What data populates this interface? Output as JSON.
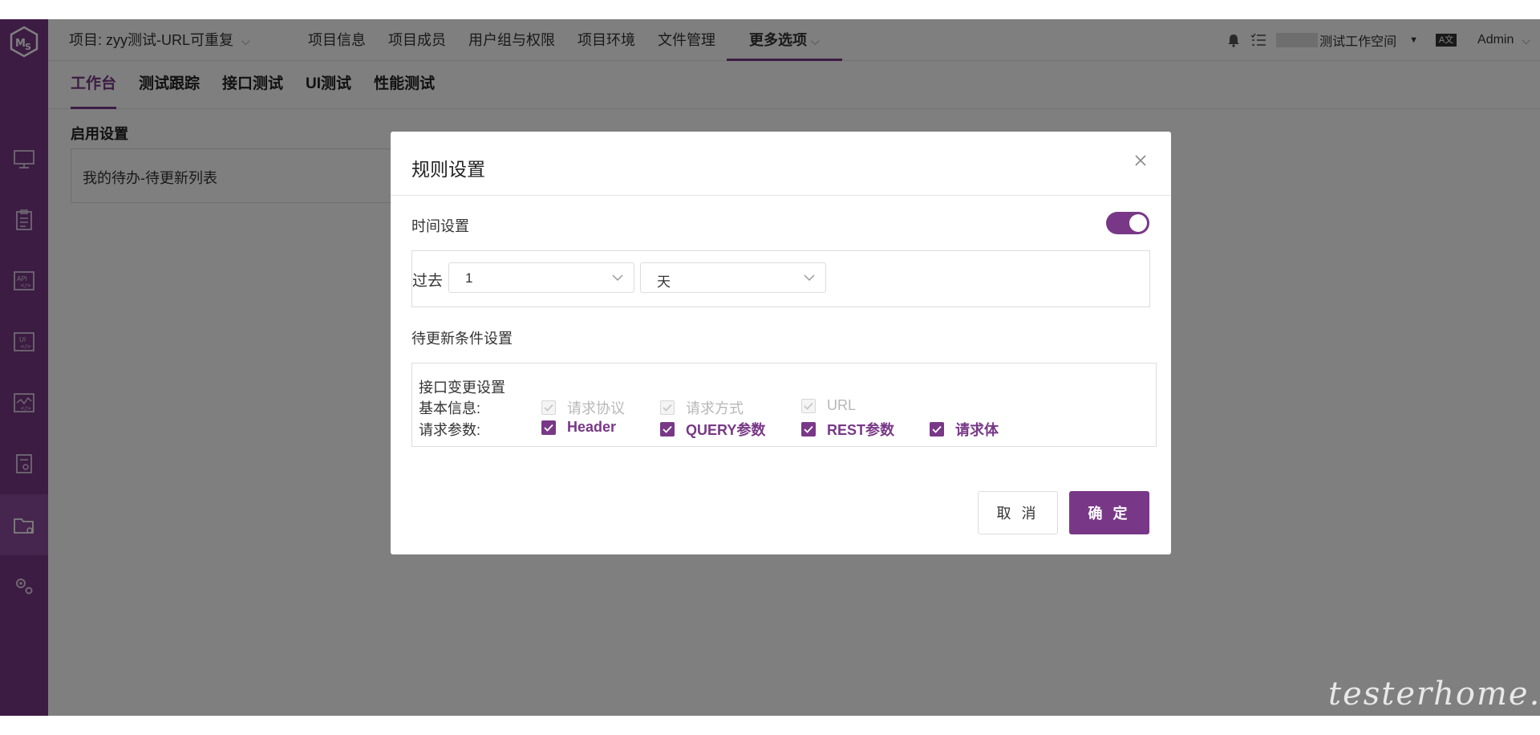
{
  "topbar": {
    "project": "项目: zyy测试-URL可重复",
    "nav": [
      "项目信息",
      "项目成员",
      "用户组与权限",
      "项目环境",
      "文件管理"
    ],
    "more": "更多选项",
    "workspace": "测试工作空间",
    "user": "Admin"
  },
  "subtabs": [
    "工作台",
    "测试跟踪",
    "接口测试",
    "UI测试",
    "性能测试"
  ],
  "content": {
    "enable_title": "启用设置",
    "todo_card": "我的待办-待更新列表"
  },
  "dialog": {
    "title": "规则设置",
    "time_label": "时间设置",
    "time_enabled": true,
    "past_label": "过去",
    "amount": "1",
    "unit": "天",
    "condition_label": "待更新条件设置",
    "condition_title": "接口变更设置",
    "basic_label": "基本信息:",
    "basic_options": [
      {
        "label": "请求协议",
        "checked": true,
        "disabled": true
      },
      {
        "label": "请求方式",
        "checked": true,
        "disabled": true
      },
      {
        "label": "URL",
        "checked": true,
        "disabled": true
      }
    ],
    "param_label": "请求参数:",
    "param_options": [
      {
        "label": "Header",
        "checked": true
      },
      {
        "label": "QUERY参数",
        "checked": true
      },
      {
        "label": "REST参数",
        "checked": true
      },
      {
        "label": "请求体",
        "checked": true
      }
    ],
    "cancel": "取 消",
    "confirm": "确 定"
  },
  "watermark": "testerhome.com",
  "colors": {
    "accent": "#783887",
    "overlay": "rgba(0,0,0,0.5)"
  }
}
